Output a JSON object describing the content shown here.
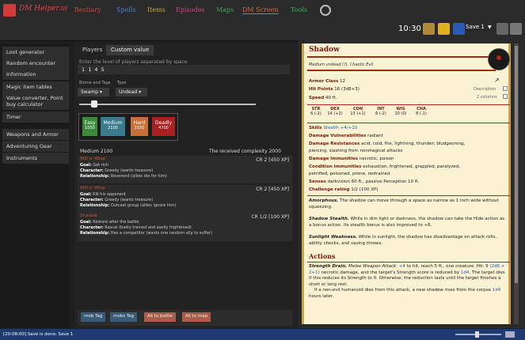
{
  "app": {
    "name": "DM Helper.ui"
  },
  "menu": [
    {
      "label": "Bestiary",
      "color": "#c84a3a"
    },
    {
      "label": "Spells",
      "color": "#4a7fd4"
    },
    {
      "label": "Items",
      "color": "#c8a838"
    },
    {
      "label": "Episodes",
      "color": "#c84a8a"
    },
    {
      "label": "Maps",
      "color": "#3aa85a"
    },
    {
      "label": "DM Screen",
      "color": "#d86a3a"
    },
    {
      "label": "Tools",
      "color": "#3ab85a"
    }
  ],
  "toolbar": {
    "time": "10:30",
    "save_label": "Save 1"
  },
  "leftnav": {
    "group1": [
      "Loot generator",
      "Random encounter",
      "Information",
      "Magic item tables",
      "Value converter, Point buy calculator",
      "Timer"
    ],
    "group2": [
      "Weapons and Armor",
      "Adventuring Gear",
      "Instruments"
    ]
  },
  "encounter": {
    "tabs": [
      "Players",
      "Custom value"
    ],
    "input_label": "Enter the level of players separated by space",
    "input_value": "1 1 4 5",
    "biome_label": "Biome and Tags",
    "type_label": "Type",
    "biome_value": "Swamp",
    "type_value": "Undead",
    "difficulties": [
      {
        "label": "Easy",
        "value": "1050",
        "color": "#3a8a3a"
      },
      {
        "label": "Medium",
        "value": "2100",
        "color": "#3a7a8a"
      },
      {
        "label": "Hard",
        "value": "3150",
        "color": "#c8703a"
      },
      {
        "label": "Deadly",
        "value": "4700",
        "color": "#a82020"
      }
    ],
    "selected_line": "Medium 2100",
    "complexity_line": "The received complexity 2000",
    "entries": [
      {
        "title": "Will-o'-Wisp",
        "cr": "CR 2 [450 XP]",
        "goal_k": "Goal:",
        "goal": "Get rich",
        "char_k": "Character:",
        "char": "Greedy (wants treasure)",
        "rel_k": "Relationship:",
        "rel": "Reverend (allies die for him)"
      },
      {
        "title": "Will-o'-Wisp",
        "cr": "CR 2 [450 XP]",
        "goal_k": "Goal:",
        "goal": "Kill his opponent",
        "char_k": "Character:",
        "char": "Greedy (wants treasure)",
        "rel_k": "Relationship:",
        "rel": "Outcast group (allies ignore him)"
      },
      {
        "title": "Shadow",
        "cr": "CR 1/2 [100 XP]",
        "goal_k": "Goal:",
        "goal": "Restore after the battle",
        "char_k": "Character:",
        "char": "Rascal (badly trained and easily frightened)",
        "rel_k": "Relationship:",
        "rel": "Has a competitor (wants one random ally to suffer)"
      }
    ],
    "buttons": [
      "mob Tag",
      "mobs Tag",
      "All to battle",
      "All to map"
    ]
  },
  "statblock": {
    "name": "Shadow",
    "subtitle": "Medium undead (?), Chaotic Evil",
    "ac_k": "Armor Class",
    "ac": "12",
    "hp_k": "Hit Points",
    "hp": "16 (3d8+3)",
    "speed_k": "Speed",
    "speed": "40 ft.",
    "description_label": "Description",
    "columns_label": "2 columns",
    "abilities": [
      {
        "name": "STR",
        "value": "6 (-2)"
      },
      {
        "name": "DEX",
        "value": "14 (+2)"
      },
      {
        "name": "CON",
        "value": "13 (+1)"
      },
      {
        "name": "INT",
        "value": "6 (-2)"
      },
      {
        "name": "WIS",
        "value": "10 (0)"
      },
      {
        "name": "CHA",
        "value": "8 (-1)"
      }
    ],
    "skills_k": "Skills",
    "skills": "Stealth +4/+10",
    "vuln_k": "Damage Vulnerabilities",
    "vuln": "radiant",
    "res_k": "Damage Resistances",
    "res1": "acid, cold, fire, lightning, thunder; bludgeoning,",
    "res2": "piercing, slashing from nonmagical attacks",
    "imm_k": "Damage Immunities",
    "imm": "necrotic, poison",
    "cond_k": "Condition Immunities",
    "cond": "exhaustion, frightened, grappled, paralyzed,",
    "cond2": "petrified, poisoned, prone, restrained",
    "senses_k": "Senses",
    "senses": "darkvision 60 ft., passive Perception 10 ft.",
    "cr_k": "Challenge rating",
    "cr": "1/2 (100 XP)",
    "traits": [
      {
        "name": "Amorphous.",
        "text": "The shadow can move through a space as narrow as 1 inch wide without squeezing."
      },
      {
        "name": "Shadow Stealth.",
        "text": "While in dim light or darkness, the shadow can take the Hide action as a bonus action. Its stealth bonus is also improved to +6."
      },
      {
        "name": "Sunlight Weakness.",
        "text": "While in sunlight, the shadow has disadvantage on attack rolls, ability checks, and saving throws."
      }
    ],
    "actions_header": "Actions",
    "action": {
      "name": "Strength Drain.",
      "attack": "Melee Weapon Attack:",
      "t1": "+4",
      "t2": "to hit, reach 5 ft., one creature.",
      "t3": "Hit: 9",
      "t4": "(2d6 + 2+1)",
      "t5": "necrotic damage, and the target's Strength score is reduced by",
      "t6": "1d4",
      "t7": ". The target dies if this reduces its Strength to 0. Otherwise, the reduction lasts until the target finishes a short or long rest.",
      "t8": "If a non-evil humanoid dies from this attack, a new shadow rises from the corpse",
      "t9": "1d4",
      "t10": "hours later."
    }
  },
  "statusbar": {
    "text": "[20:08:00] Save is done: Save 1"
  }
}
